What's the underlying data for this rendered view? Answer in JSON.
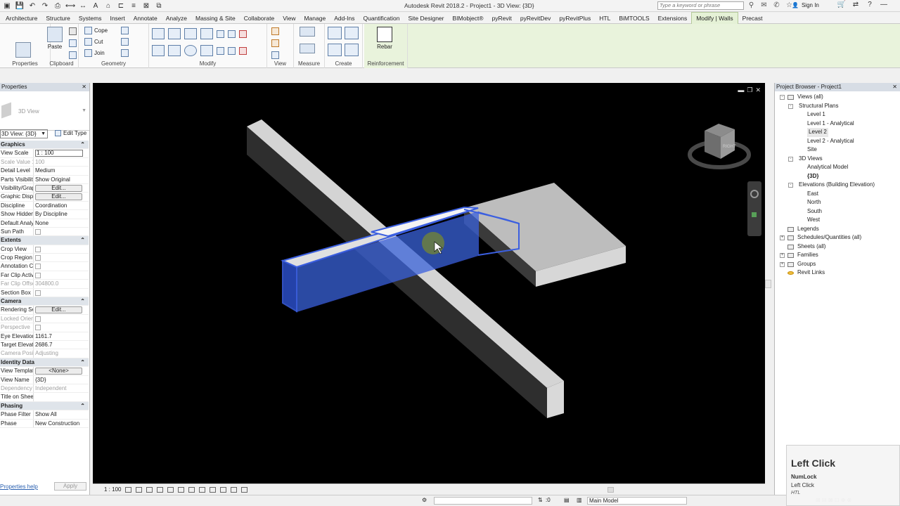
{
  "window": {
    "title": "Autodesk Revit 2018.2 -    Project1 - 3D View: {3D}",
    "search_placeholder": "Type a keyword or phrase",
    "sign_in": "Sign In",
    "help": "?"
  },
  "ribbon": {
    "tabs": [
      "Architecture",
      "Structure",
      "Systems",
      "Insert",
      "Annotate",
      "Analyze",
      "Massing & Site",
      "Collaborate",
      "View",
      "Manage",
      "Add-Ins",
      "Quantification",
      "Site Designer",
      "BIMobject®",
      "pyRevit",
      "pyRevitDev",
      "pyRevitPlus",
      "HTL",
      "BiMTOOLS",
      "Extensions",
      "Modify | Walls",
      "Precast"
    ],
    "active_tab": "Modify | Walls",
    "panels": {
      "properties": "Properties",
      "clipboard": "Clipboard",
      "geometry": "Geometry",
      "modify": "Modify",
      "view": "View",
      "measure": "Measure",
      "create": "Create",
      "reinforcement": "Reinforcement"
    },
    "buttons": {
      "paste": "Paste",
      "cope": "Cope",
      "cut": "Cut",
      "join": "Join",
      "rebar": "Rebar"
    },
    "accent": "#e9f3dc"
  },
  "properties": {
    "header": "Properties",
    "type_name": "3D View",
    "view_dropdown": "3D View: {3D}",
    "edit_type": "Edit Type",
    "rows": [
      {
        "k": "Graphics",
        "section": true
      },
      {
        "k": "View Scale",
        "v": "1 : 100",
        "input": true
      },
      {
        "k": "Scale Value    1:",
        "v": "100",
        "disabled": true
      },
      {
        "k": "Detail Level",
        "v": "Medium"
      },
      {
        "k": "Parts Visibility",
        "v": "Show Original"
      },
      {
        "k": "Visibility/Graphics...",
        "v": "Edit...",
        "button": true
      },
      {
        "k": "Graphic Display...",
        "v": "Edit...",
        "button": true
      },
      {
        "k": "Discipline",
        "v": "Coordination"
      },
      {
        "k": "Show Hidden Li...",
        "v": "By Discipline"
      },
      {
        "k": "Default Analysis...",
        "v": "None"
      },
      {
        "k": "Sun Path",
        "v": "",
        "check": true
      },
      {
        "k": "Extents",
        "section": true
      },
      {
        "k": "Crop View",
        "v": "",
        "check": true
      },
      {
        "k": "Crop Region Vis...",
        "v": "",
        "check": true
      },
      {
        "k": "Annotation Crop",
        "v": "",
        "check": true
      },
      {
        "k": "Far Clip Active",
        "v": "",
        "check": true
      },
      {
        "k": "Far Clip Offset",
        "v": "304800.0",
        "disabled": true
      },
      {
        "k": "Section Box",
        "v": "",
        "check": true
      },
      {
        "k": "Camera",
        "section": true
      },
      {
        "k": "Rendering Setti...",
        "v": "Edit...",
        "button": true
      },
      {
        "k": "Locked Orientat...",
        "v": "",
        "check": true,
        "disabled": true
      },
      {
        "k": "Perspective",
        "v": "",
        "check": true,
        "disabled": true
      },
      {
        "k": "Eye Elevation",
        "v": "1161.7"
      },
      {
        "k": "Target Elevation",
        "v": "2686.7"
      },
      {
        "k": "Camera Position",
        "v": "Adjusting",
        "disabled": true
      },
      {
        "k": "Identity Data",
        "section": true
      },
      {
        "k": "View Template",
        "v": "<None>",
        "button": true
      },
      {
        "k": "View Name",
        "v": "{3D}"
      },
      {
        "k": "Dependency",
        "v": "Independent",
        "disabled": true
      },
      {
        "k": "Title on Sheet",
        "v": ""
      },
      {
        "k": "Phasing",
        "section": true
      },
      {
        "k": "Phase Filter",
        "v": "Show All"
      },
      {
        "k": "Phase",
        "v": "New Construction"
      }
    ],
    "help_link": "Properties help",
    "apply": "Apply"
  },
  "viewport": {
    "scale": "1 : 100",
    "viewcube_face": "RIGHT",
    "background": "#000000"
  },
  "browser": {
    "header": "Project Browser - Project1",
    "tree": [
      {
        "label": "Views (all)",
        "level": 0,
        "expander": "-",
        "icon": true
      },
      {
        "label": "Structural Plans",
        "level": 1,
        "expander": "-"
      },
      {
        "label": "Level 1",
        "level": 2
      },
      {
        "label": "Level 1 - Analytical",
        "level": 2
      },
      {
        "label": "Level 2",
        "level": 2,
        "selected": true
      },
      {
        "label": "Level 2 - Analytical",
        "level": 2
      },
      {
        "label": "Site",
        "level": 2
      },
      {
        "label": "3D Views",
        "level": 1,
        "expander": "-"
      },
      {
        "label": "Analytical Model",
        "level": 2
      },
      {
        "label": "{3D}",
        "level": 2,
        "bold": true
      },
      {
        "label": "Elevations (Building Elevation)",
        "level": 1,
        "expander": "-"
      },
      {
        "label": "East",
        "level": 2
      },
      {
        "label": "North",
        "level": 2
      },
      {
        "label": "South",
        "level": 2
      },
      {
        "label": "West",
        "level": 2
      },
      {
        "label": "Legends",
        "level": 0,
        "icon": true
      },
      {
        "label": "Schedules/Quantities (all)",
        "level": 0,
        "expander": "+",
        "icon": true
      },
      {
        "label": "Sheets (all)",
        "level": 0,
        "icon": true
      },
      {
        "label": "Families",
        "level": 0,
        "expander": "+",
        "icon": true
      },
      {
        "label": "Groups",
        "level": 0,
        "expander": "+",
        "icon": true
      },
      {
        "label": "Revit Links",
        "level": 0,
        "icon": "link"
      }
    ]
  },
  "status": {
    "coord": ":0",
    "model": "Main Model"
  },
  "keycast": {
    "action": "Left Click",
    "line1": "NumLock",
    "line2": "Left Click",
    "line3": "HTL"
  }
}
